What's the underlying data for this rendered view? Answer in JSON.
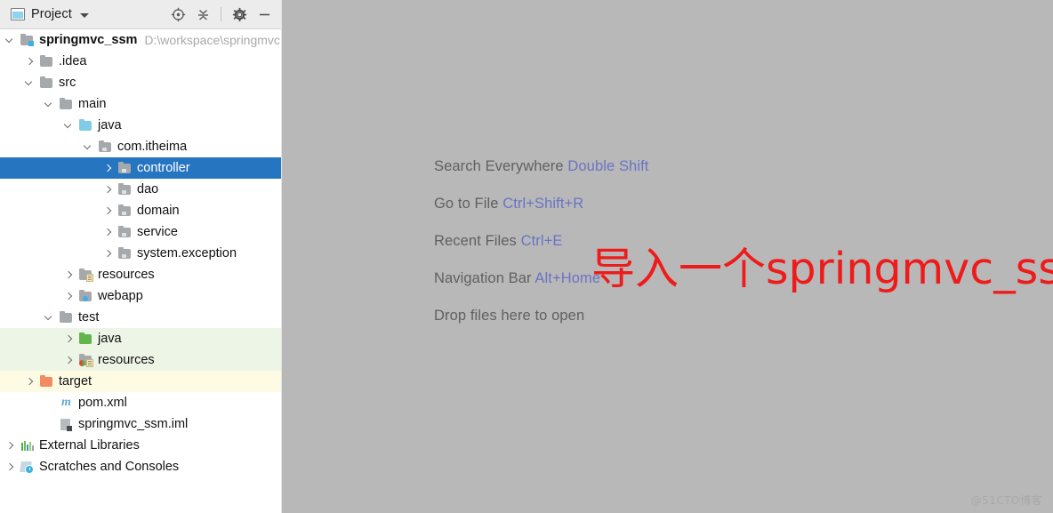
{
  "toolwindow": {
    "tab_label": "Project",
    "tab_icon": "project-window-icon",
    "dropdown_icon": "chevron-down-icon",
    "actions": [
      {
        "name": "locate-icon",
        "title": "Select Opened File"
      },
      {
        "name": "collapse-all-icon",
        "title": "Collapse All"
      },
      {
        "name": "gear-icon",
        "title": "Settings"
      },
      {
        "name": "minimize-icon",
        "title": "Hide"
      }
    ]
  },
  "tree": {
    "rows": [
      {
        "label": "springmvc_ssm",
        "sub": "D:\\workspace\\springmvc",
        "indent": 0,
        "arrow": "down",
        "icon": "module-folder-icon",
        "bold": true,
        "state": "normal"
      },
      {
        "label": ".idea",
        "sub": "",
        "indent": 1,
        "arrow": "right",
        "icon": "folder-icon",
        "bold": false,
        "state": "normal"
      },
      {
        "label": "src",
        "sub": "",
        "indent": 1,
        "arrow": "down",
        "icon": "folder-icon",
        "bold": false,
        "state": "normal"
      },
      {
        "label": "main",
        "sub": "",
        "indent": 2,
        "arrow": "down",
        "icon": "folder-icon",
        "bold": false,
        "state": "normal"
      },
      {
        "label": "java",
        "sub": "",
        "indent": 3,
        "arrow": "down",
        "icon": "source-root-folder-icon",
        "bold": false,
        "state": "normal"
      },
      {
        "label": "com.itheima",
        "sub": "",
        "indent": 4,
        "arrow": "down",
        "icon": "package-icon",
        "bold": false,
        "state": "normal"
      },
      {
        "label": "controller",
        "sub": "",
        "indent": 5,
        "arrow": "right",
        "icon": "package-icon",
        "bold": false,
        "state": "selected"
      },
      {
        "label": "dao",
        "sub": "",
        "indent": 5,
        "arrow": "right",
        "icon": "package-icon",
        "bold": false,
        "state": "normal"
      },
      {
        "label": "domain",
        "sub": "",
        "indent": 5,
        "arrow": "right",
        "icon": "package-icon",
        "bold": false,
        "state": "normal"
      },
      {
        "label": "service",
        "sub": "",
        "indent": 5,
        "arrow": "right",
        "icon": "package-icon",
        "bold": false,
        "state": "normal"
      },
      {
        "label": "system.exception",
        "sub": "",
        "indent": 5,
        "arrow": "right",
        "icon": "package-icon",
        "bold": false,
        "state": "normal"
      },
      {
        "label": "resources",
        "sub": "",
        "indent": 3,
        "arrow": "right",
        "icon": "resources-folder-icon",
        "bold": false,
        "state": "normal"
      },
      {
        "label": "webapp",
        "sub": "",
        "indent": 3,
        "arrow": "right",
        "icon": "webapp-folder-icon",
        "bold": false,
        "state": "normal"
      },
      {
        "label": "test",
        "sub": "",
        "indent": 2,
        "arrow": "down",
        "icon": "folder-icon",
        "bold": false,
        "state": "normal"
      },
      {
        "label": "java",
        "sub": "",
        "indent": 3,
        "arrow": "right",
        "icon": "test-source-root-folder-icon",
        "bold": false,
        "state": "test-root"
      },
      {
        "label": "resources",
        "sub": "",
        "indent": 3,
        "arrow": "right",
        "icon": "test-resources-folder-icon",
        "bold": false,
        "state": "test-root"
      },
      {
        "label": "target",
        "sub": "",
        "indent": 1,
        "arrow": "right",
        "icon": "excluded-folder-icon",
        "bold": false,
        "state": "excluded"
      },
      {
        "label": "pom.xml",
        "sub": "",
        "indent": 2,
        "arrow": "none",
        "icon": "maven-pom-icon",
        "bold": false,
        "state": "normal"
      },
      {
        "label": "springmvc_ssm.iml",
        "sub": "",
        "indent": 2,
        "arrow": "none",
        "icon": "iml-file-icon",
        "bold": false,
        "state": "normal"
      },
      {
        "label": "External Libraries",
        "sub": "",
        "indent": 0,
        "arrow": "right",
        "icon": "external-libraries-icon",
        "bold": false,
        "state": "normal"
      },
      {
        "label": "Scratches and Consoles",
        "sub": "",
        "indent": 0,
        "arrow": "right",
        "icon": "scratches-icon",
        "bold": false,
        "state": "normal"
      }
    ]
  },
  "editor": {
    "hints": [
      {
        "action": "Search Everywhere",
        "shortcut": "Double Shift"
      },
      {
        "action": "Go to File",
        "shortcut": "Ctrl+Shift+R"
      },
      {
        "action": "Recent Files",
        "shortcut": "Ctrl+E"
      },
      {
        "action": "Navigation Bar",
        "shortcut": "Alt+Home"
      },
      {
        "action": "Drop files here to open",
        "shortcut": ""
      }
    ],
    "watermark": "@51CTO博客"
  },
  "annotation": {
    "text": "导入一个springmvc_ssm文件",
    "color": "#ef1b1b"
  },
  "colors": {
    "selection": "#2675c0",
    "test_root_bg": "#edf5e6",
    "excluded_bg": "#fdfbe3",
    "editor_bg": "#b8b8b8",
    "shortcut_text": "#6b73c4",
    "hint_text": "#5f6062"
  }
}
